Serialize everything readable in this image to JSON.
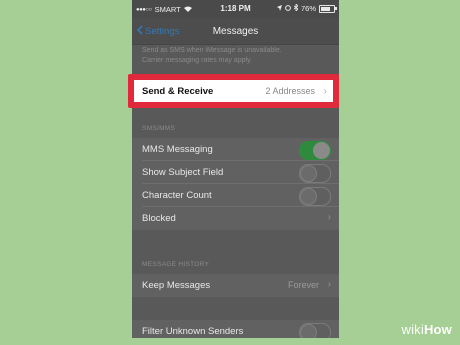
{
  "status_bar": {
    "carrier": "SMART",
    "time": "1:18 PM",
    "battery": "76%",
    "battery_level": 0.76
  },
  "nav": {
    "back_label": "Settings",
    "title": "Messages"
  },
  "info_text": {
    "line1": "Send as SMS when iMessage is unavailable.",
    "line2": "Carrier messaging rates may apply."
  },
  "send_receive": {
    "label": "Send & Receive",
    "value": "2 Addresses",
    "highlight_color": "#e0293a"
  },
  "sms_mms": {
    "header": "SMS/MMS",
    "mms_messaging": {
      "label": "MMS Messaging",
      "on": true
    },
    "show_subject": {
      "label": "Show Subject Field",
      "on": false
    },
    "character_count": {
      "label": "Character Count",
      "on": false
    },
    "blocked": {
      "label": "Blocked"
    }
  },
  "history": {
    "header": "MESSAGE HISTORY",
    "keep_messages": {
      "label": "Keep Messages",
      "value": "Forever"
    }
  },
  "filter": {
    "label": "Filter Unknown Senders",
    "on": false
  },
  "watermark": {
    "part1": "wiki",
    "part2": "How"
  },
  "colors": {
    "toggle_on": "#2e8a3c",
    "link": "#3478b8",
    "background": "#a5cf94"
  }
}
